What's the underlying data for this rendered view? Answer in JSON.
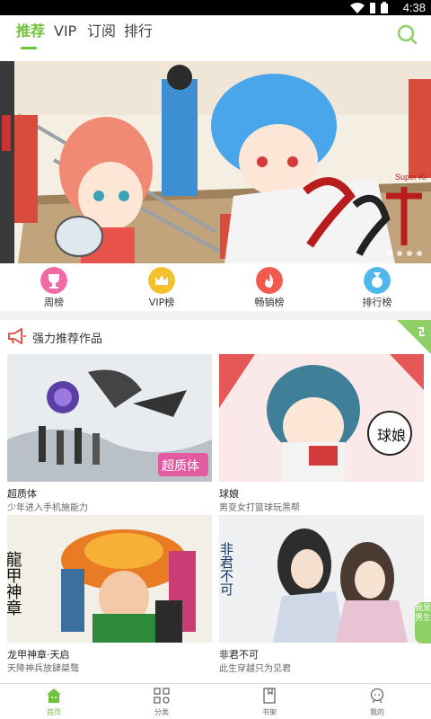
{
  "status_bar": {
    "time": "4:38"
  },
  "top_nav": {
    "tabs": [
      {
        "label": "推荐"
      },
      {
        "label": "VIP"
      },
      {
        "label": "订阅"
      },
      {
        "label": "排行"
      }
    ],
    "active_index": 0
  },
  "banner": {
    "slide_count": 4,
    "active_slide": 0,
    "image_text": "Super Ki"
  },
  "rank_bar": {
    "items": [
      {
        "label": "周榜",
        "icon": "trophy-icon",
        "color": "#f06aa5"
      },
      {
        "label": "VIP榜",
        "icon": "crown-icon",
        "color": "#f3c02e"
      },
      {
        "label": "畅销榜",
        "icon": "fire-icon",
        "color": "#f25a4f"
      },
      {
        "label": "排行榜",
        "icon": "medal-icon",
        "color": "#4fb7ea"
      }
    ]
  },
  "section": {
    "title": "强力推荐作品",
    "icon": "megaphone-icon",
    "refresh_icon": "refresh-icon",
    "cards": [
      {
        "title": "超质体",
        "desc": "少年进入手机施能力",
        "cover_text": "超质体"
      },
      {
        "title": "球娘",
        "desc": "男变女打篮球玩黑帮",
        "cover_text": "球娘"
      },
      {
        "title": "龙甲神章·天启",
        "desc": "天降神兵放肆桀骜",
        "cover_text": "龍甲神章"
      },
      {
        "title": "非君不可",
        "desc": "此生穿越只为见君",
        "cover_text": "非君不可",
        "badge": "我是男生"
      }
    ]
  },
  "bottom_nav": {
    "items": [
      {
        "label": "首页",
        "icon": "home-icon"
      },
      {
        "label": "分类",
        "icon": "category-icon"
      },
      {
        "label": "书架",
        "icon": "bookshelf-icon"
      },
      {
        "label": "我的",
        "icon": "profile-icon"
      }
    ],
    "active_index": 0
  },
  "colors": {
    "accent": "#6fc33a"
  }
}
